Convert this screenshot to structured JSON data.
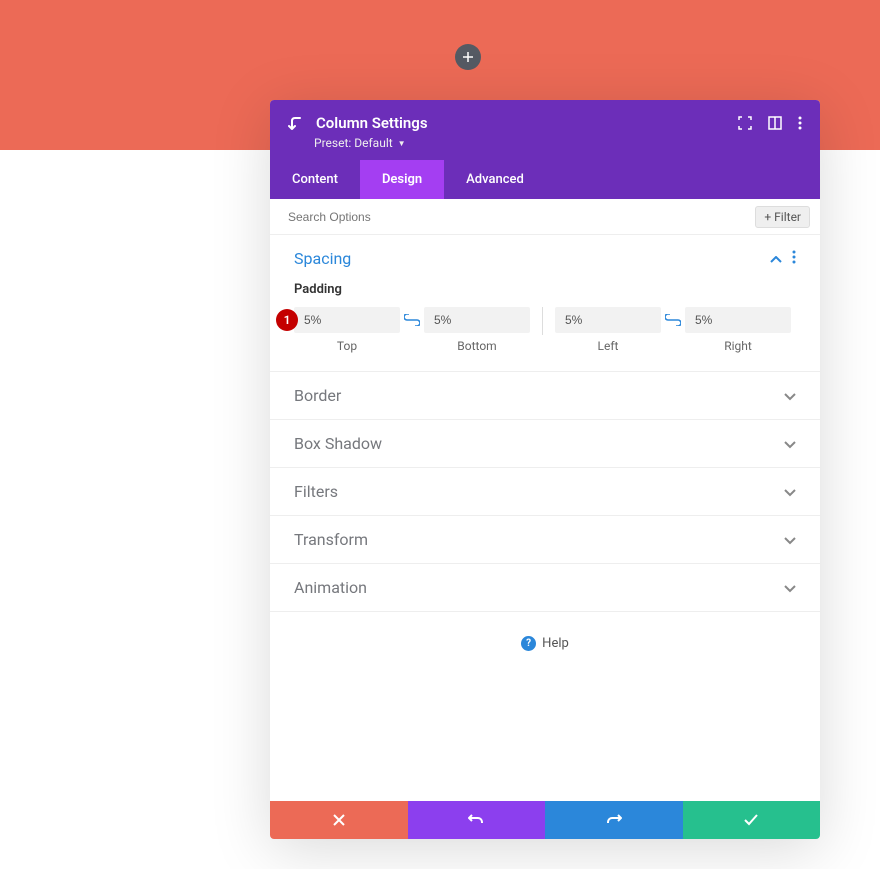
{
  "header": {
    "title": "Column Settings",
    "preset_label": "Preset:",
    "preset_value": "Default"
  },
  "tabs": {
    "content": "Content",
    "design": "Design",
    "advanced": "Advanced"
  },
  "search": {
    "placeholder": "Search Options",
    "filter_label": "Filter"
  },
  "sections": {
    "spacing": "Spacing",
    "border": "Border",
    "box_shadow": "Box Shadow",
    "filters": "Filters",
    "transform": "Transform",
    "animation": "Animation"
  },
  "spacing": {
    "subtitle": "Padding",
    "top_value": "5%",
    "top_label": "Top",
    "bottom_value": "5%",
    "bottom_label": "Bottom",
    "left_value": "5%",
    "left_label": "Left",
    "right_value": "5%",
    "right_label": "Right"
  },
  "help": "Help",
  "annotation": "1"
}
